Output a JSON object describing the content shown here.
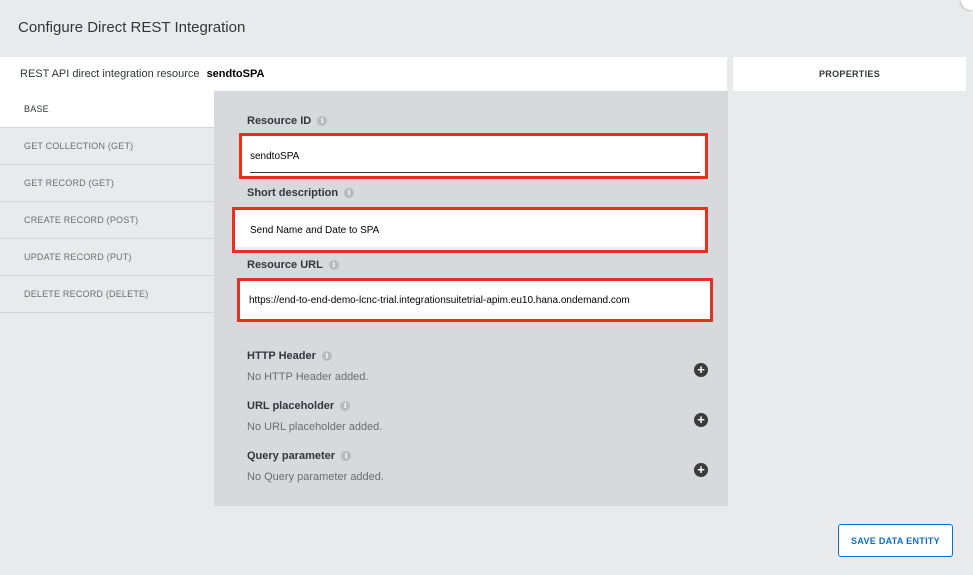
{
  "dialog": {
    "title": "Configure Direct REST Integration"
  },
  "resource_bar": {
    "label": "REST API direct integration resource",
    "value": "sendtoSPA"
  },
  "properties_tab": "PROPERTIES",
  "sidebar": {
    "items": [
      {
        "label": "BASE"
      },
      {
        "label": "GET COLLECTION (GET)"
      },
      {
        "label": "GET RECORD (GET)"
      },
      {
        "label": "CREATE RECORD (POST)"
      },
      {
        "label": "UPDATE RECORD (PUT)"
      },
      {
        "label": "DELETE RECORD (DELETE)"
      }
    ]
  },
  "form": {
    "resource_id": {
      "label": "Resource ID",
      "value": "sendtoSPA"
    },
    "short_description": {
      "label": "Short description",
      "value": "Send Name and Date to SPA"
    },
    "resource_url": {
      "label": "Resource URL",
      "value": "https://end-to-end-demo-lcnc-trial.integrationsuitetrial-apim.eu10.hana.ondemand.com"
    }
  },
  "sections": {
    "http_header": {
      "title": "HTTP Header",
      "empty": "No HTTP Header added."
    },
    "url_placeholder": {
      "title": "URL placeholder",
      "empty": "No URL placeholder added."
    },
    "query_parameter": {
      "title": "Query parameter",
      "empty": "No Query parameter added."
    }
  },
  "footer": {
    "save_label": "SAVE DATA ENTITY"
  },
  "colors": {
    "highlight_border": "#e8301c",
    "accent": "#0a6ed1"
  },
  "icons": {
    "info": "info-icon",
    "add": "plus-circle-icon"
  }
}
